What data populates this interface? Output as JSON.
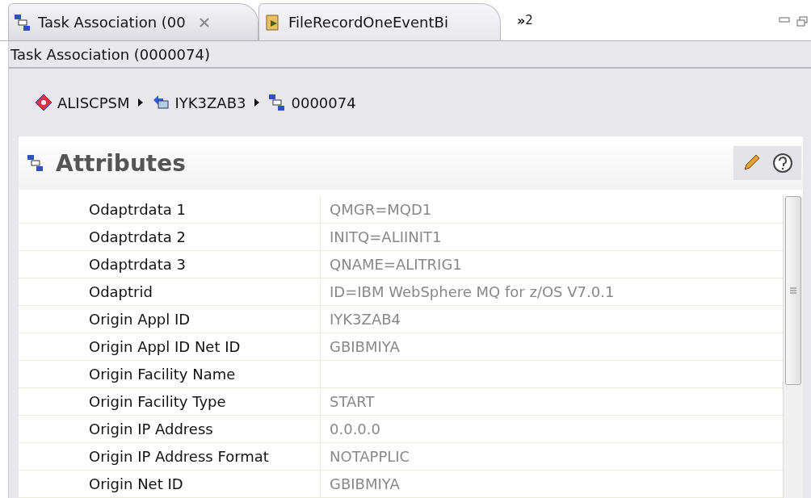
{
  "tabs": [
    {
      "label": "Task Association (00",
      "selected": true,
      "closable": true
    },
    {
      "label": "FileRecordOneEventBi",
      "selected": false,
      "closable": false
    }
  ],
  "overflow": {
    "symbol": "»",
    "count": "2"
  },
  "editor_title": "Task Association (0000074)",
  "breadcrumb": [
    "ALISCPSM",
    "IYK3ZAB3",
    "0000074"
  ],
  "section": {
    "title": "Attributes"
  },
  "rows": [
    {
      "name": "Odaptrdata 1",
      "value": "QMGR=MQD1"
    },
    {
      "name": "Odaptrdata 2",
      "value": "INITQ=ALIINIT1"
    },
    {
      "name": "Odaptrdata 3",
      "value": "QNAME=ALITRIG1"
    },
    {
      "name": "Odaptrid",
      "value": "ID=IBM WebSphere MQ for z/OS V7.0.1"
    },
    {
      "name": "Origin Appl ID",
      "value": "IYK3ZAB4"
    },
    {
      "name": "Origin Appl ID Net ID",
      "value": "GBIBMIYA"
    },
    {
      "name": "Origin Facility Name"
    },
    {
      "name": "Origin Facility Type",
      "value": "START"
    },
    {
      "name": "Origin IP Address",
      "value": "0.0.0.0"
    },
    {
      "name": "Origin IP Address Format",
      "value": "NOTAPPLIC"
    },
    {
      "name": "Origin Net ID",
      "value": "GBIBMIYA"
    }
  ]
}
